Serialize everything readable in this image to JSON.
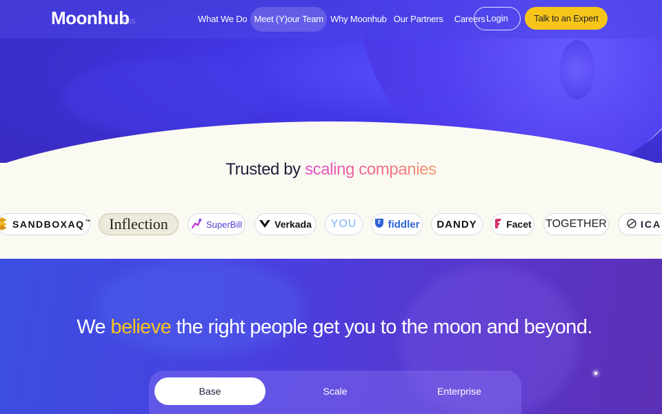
{
  "nav": {
    "logo": "Moonhub",
    "logo_faded": "ess",
    "links": [
      {
        "label": "What We Do"
      },
      {
        "label": "Meet (Y)our Team"
      },
      {
        "label": "Why Moonhub"
      },
      {
        "label": "Our Partners"
      },
      {
        "label": "Careers"
      }
    ],
    "login_label": "Login",
    "cta_label": "Talk to an Expert"
  },
  "trusted": {
    "title_prefix": "Trusted by ",
    "title_highlight": "scaling companies",
    "logos": [
      {
        "name": "SANDBOXAQ",
        "suffix": "™",
        "icon": "sandboxaq-logo-icon"
      },
      {
        "name": "Inflection",
        "icon": "inflection-logo"
      },
      {
        "name": "SuperBill",
        "icon": "superbill-logo-icon"
      },
      {
        "name": "Verkada",
        "icon": "verkada-logo-icon"
      },
      {
        "name": "YOU",
        "icon": "you-logo"
      },
      {
        "name": "fiddler",
        "icon": "fiddler-logo-icon"
      },
      {
        "name": "DANDY",
        "icon": "dandy-logo"
      },
      {
        "name": "Facet",
        "icon": "facet-logo-icon"
      },
      {
        "name": "TOGETHER",
        "icon": "together-logo"
      },
      {
        "name": "ICAN",
        "icon": "ican-logo-icon"
      }
    ]
  },
  "hero_lower": {
    "headline_pre": "We ",
    "headline_accent": "believe",
    "headline_post": " the right people get you to the moon and beyond."
  },
  "plans": {
    "tabs": [
      {
        "label": "Base",
        "active": true
      },
      {
        "label": "Scale",
        "active": false
      },
      {
        "label": "Enterprise",
        "active": false
      }
    ]
  },
  "colors": {
    "accent_yellow": "#f7c51a",
    "hero_purple": "#4338e8",
    "cream": "#fbfaf2",
    "gradient_pink": "#e050d0",
    "gradient_orange": "#f59a6a"
  }
}
